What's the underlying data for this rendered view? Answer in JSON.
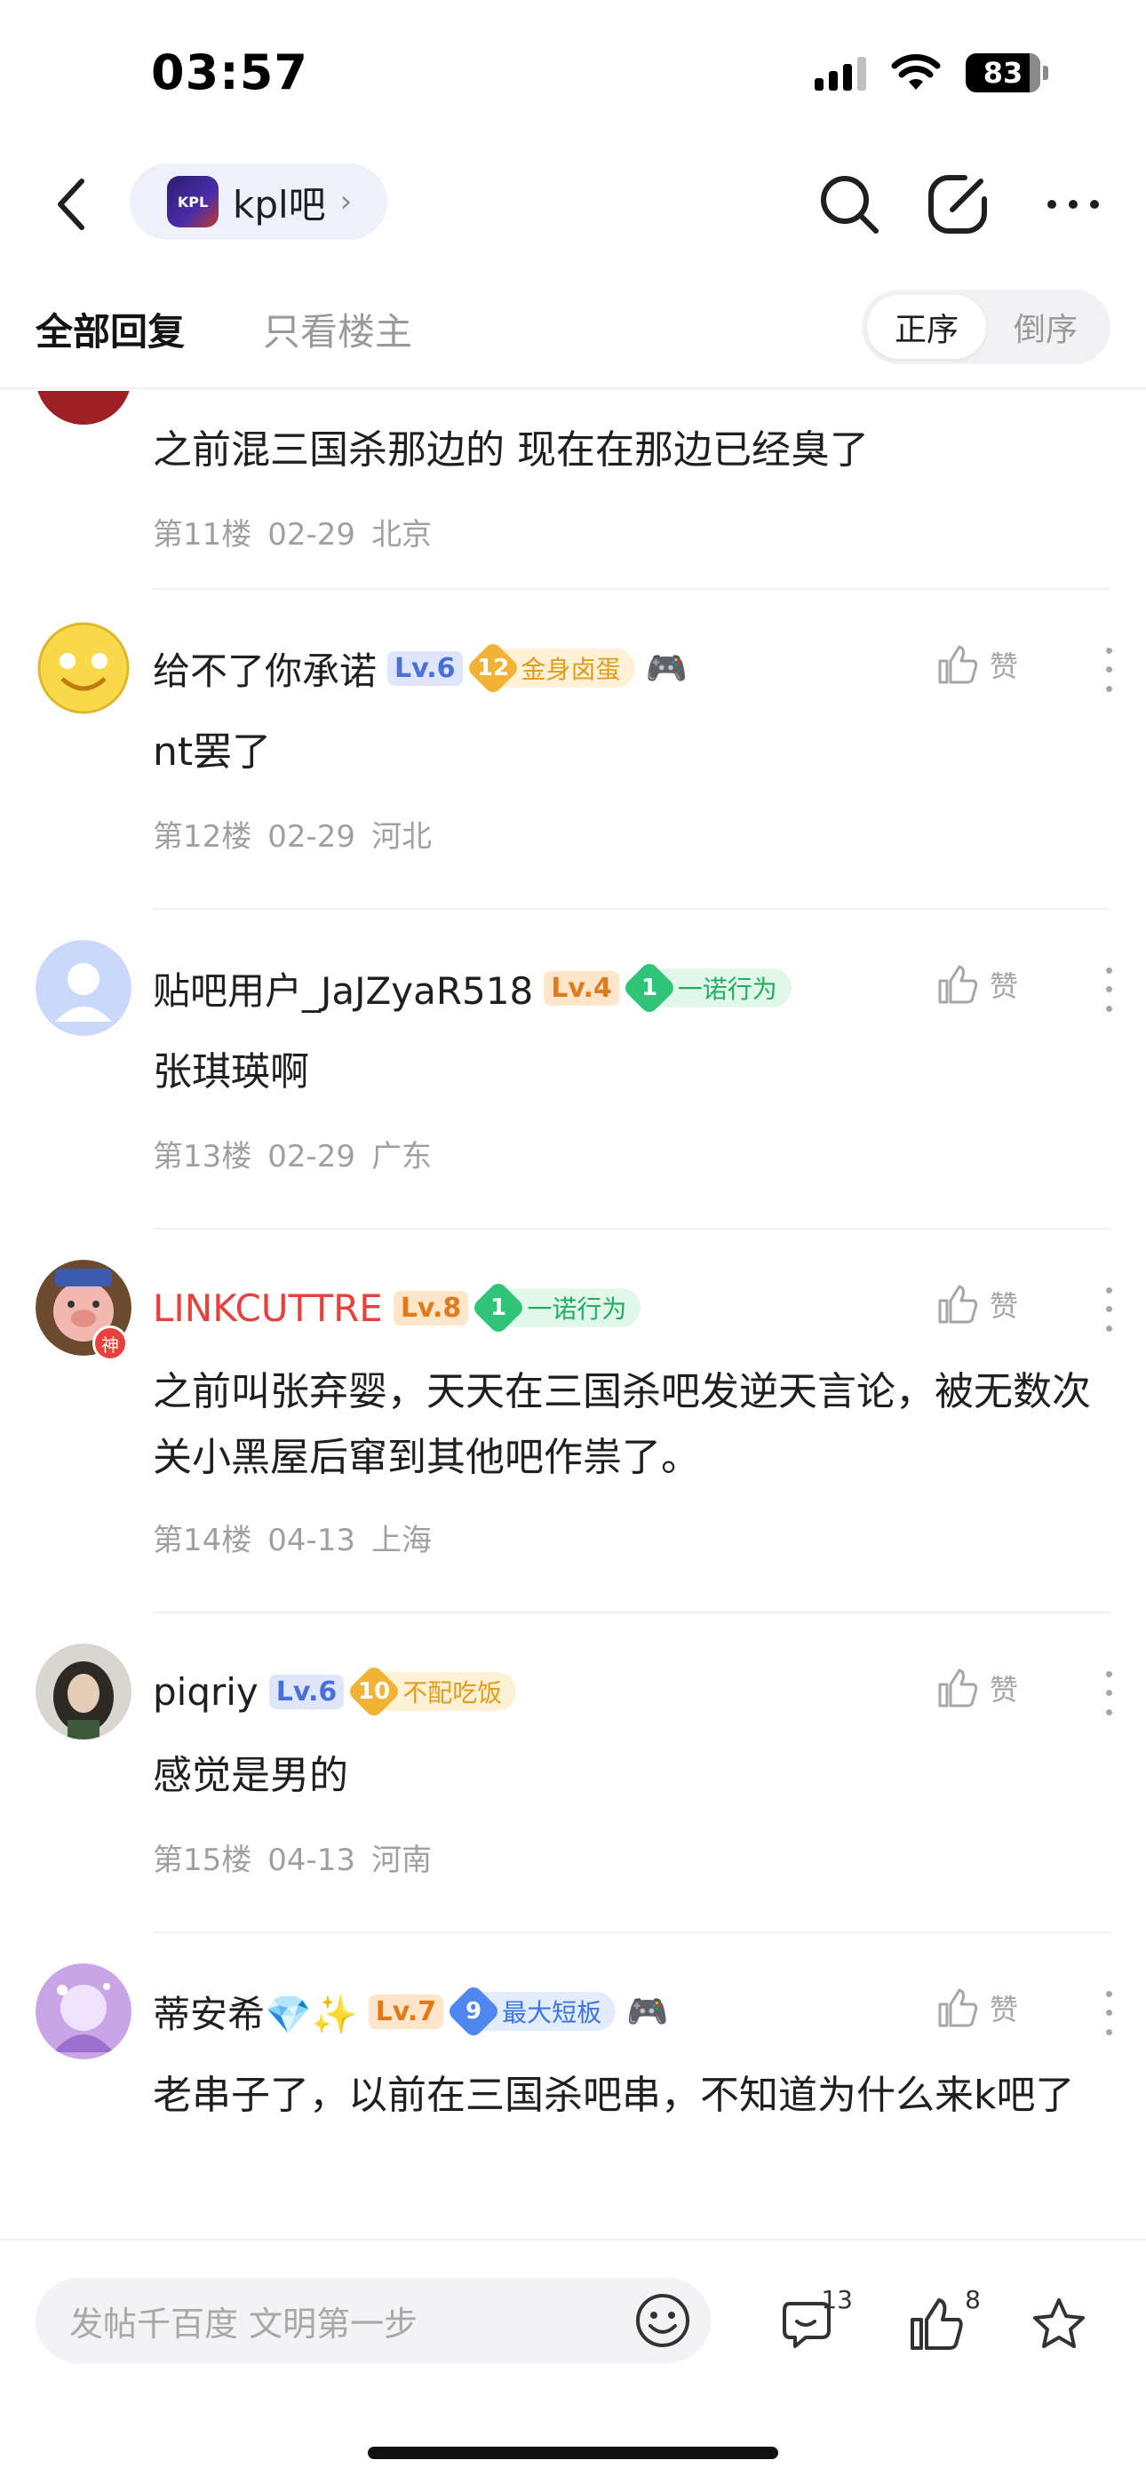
{
  "status": {
    "time": "03:57",
    "battery": "83"
  },
  "nav": {
    "forum_name": "kpl吧",
    "logo_text": "KPL"
  },
  "tabs": {
    "all": "全部回复",
    "op_only": "只看楼主",
    "order_asc": "正序",
    "order_desc": "倒序"
  },
  "like_label": "赞",
  "first_post": {
    "content": "之前混三国杀那边的 现在在那边已经臭了",
    "floor": "第11楼",
    "date": "02-29",
    "location": "北京"
  },
  "posts": [
    {
      "username": "给不了你承诺",
      "level": "Lv.6",
      "badge_num": "12",
      "badge_text": "金身卤蛋",
      "content": "nt罢了",
      "floor": "第12楼",
      "date": "02-29",
      "location": "河北"
    },
    {
      "username": "贴吧用户_JaJZyaR518",
      "level": "Lv.4",
      "badge_num": "1",
      "badge_text": "一诺行为",
      "content": "张琪瑛啊",
      "floor": "第13楼",
      "date": "02-29",
      "location": "广东"
    },
    {
      "username": "LINKCUTTRE",
      "level": "Lv.8",
      "badge_num": "1",
      "badge_text": "一诺行为",
      "content": "之前叫张弃婴，天天在三国杀吧发逆天言论，被无数次关小黑屋后窜到其他吧作祟了。",
      "floor": "第14楼",
      "date": "04-13",
      "location": "上海",
      "avatar_tag": "神"
    },
    {
      "username": "piqriy",
      "level": "Lv.6",
      "badge_num": "10",
      "badge_text": "不配吃饭",
      "content": "感觉是男的",
      "floor": "第15楼",
      "date": "04-13",
      "location": "河南"
    },
    {
      "username": "蒂安希💎✨",
      "level": "Lv.7",
      "badge_num": "9",
      "badge_text": "最大短板",
      "content": "老串子了，以前在三国杀吧串，不知道为什么来k吧了"
    }
  ],
  "bottom": {
    "placeholder": "发帖千百度 文明第一步",
    "comment_count": "13",
    "like_count": "8"
  }
}
